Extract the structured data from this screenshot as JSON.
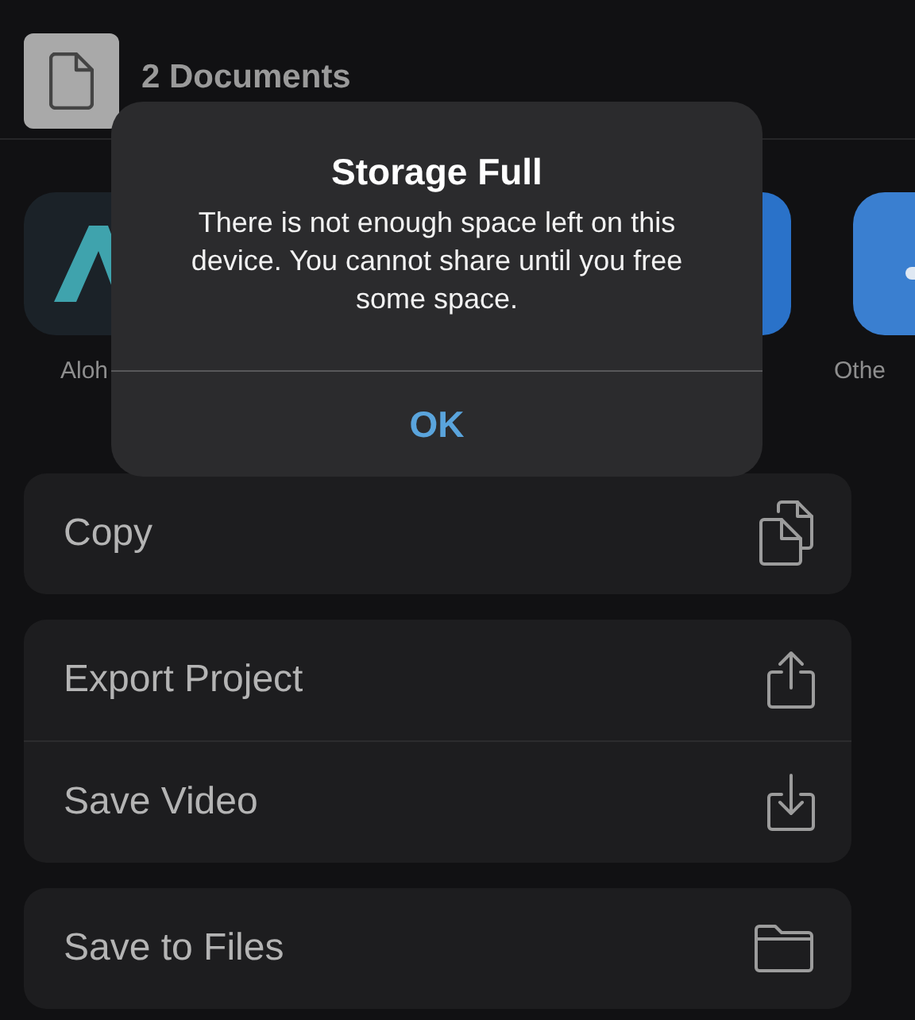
{
  "header": {
    "title": "2 Documents"
  },
  "apps": [
    {
      "kind": "letter-a",
      "label": "Aloh"
    },
    {
      "kind": "blue-square"
    },
    {
      "kind": "blue-dots",
      "label": "Othe"
    }
  ],
  "action_groups": [
    [
      {
        "label": "Copy",
        "kind": "copy"
      }
    ],
    [
      {
        "label": "Export Project",
        "kind": "export"
      },
      {
        "label": "Save Video",
        "kind": "save"
      }
    ],
    [
      {
        "label": "Save to Files",
        "kind": "folder"
      }
    ]
  ],
  "alert": {
    "title": "Storage Full",
    "message": "There is not enough space left on this device. You cannot share until you free some space.",
    "button": "OK"
  }
}
